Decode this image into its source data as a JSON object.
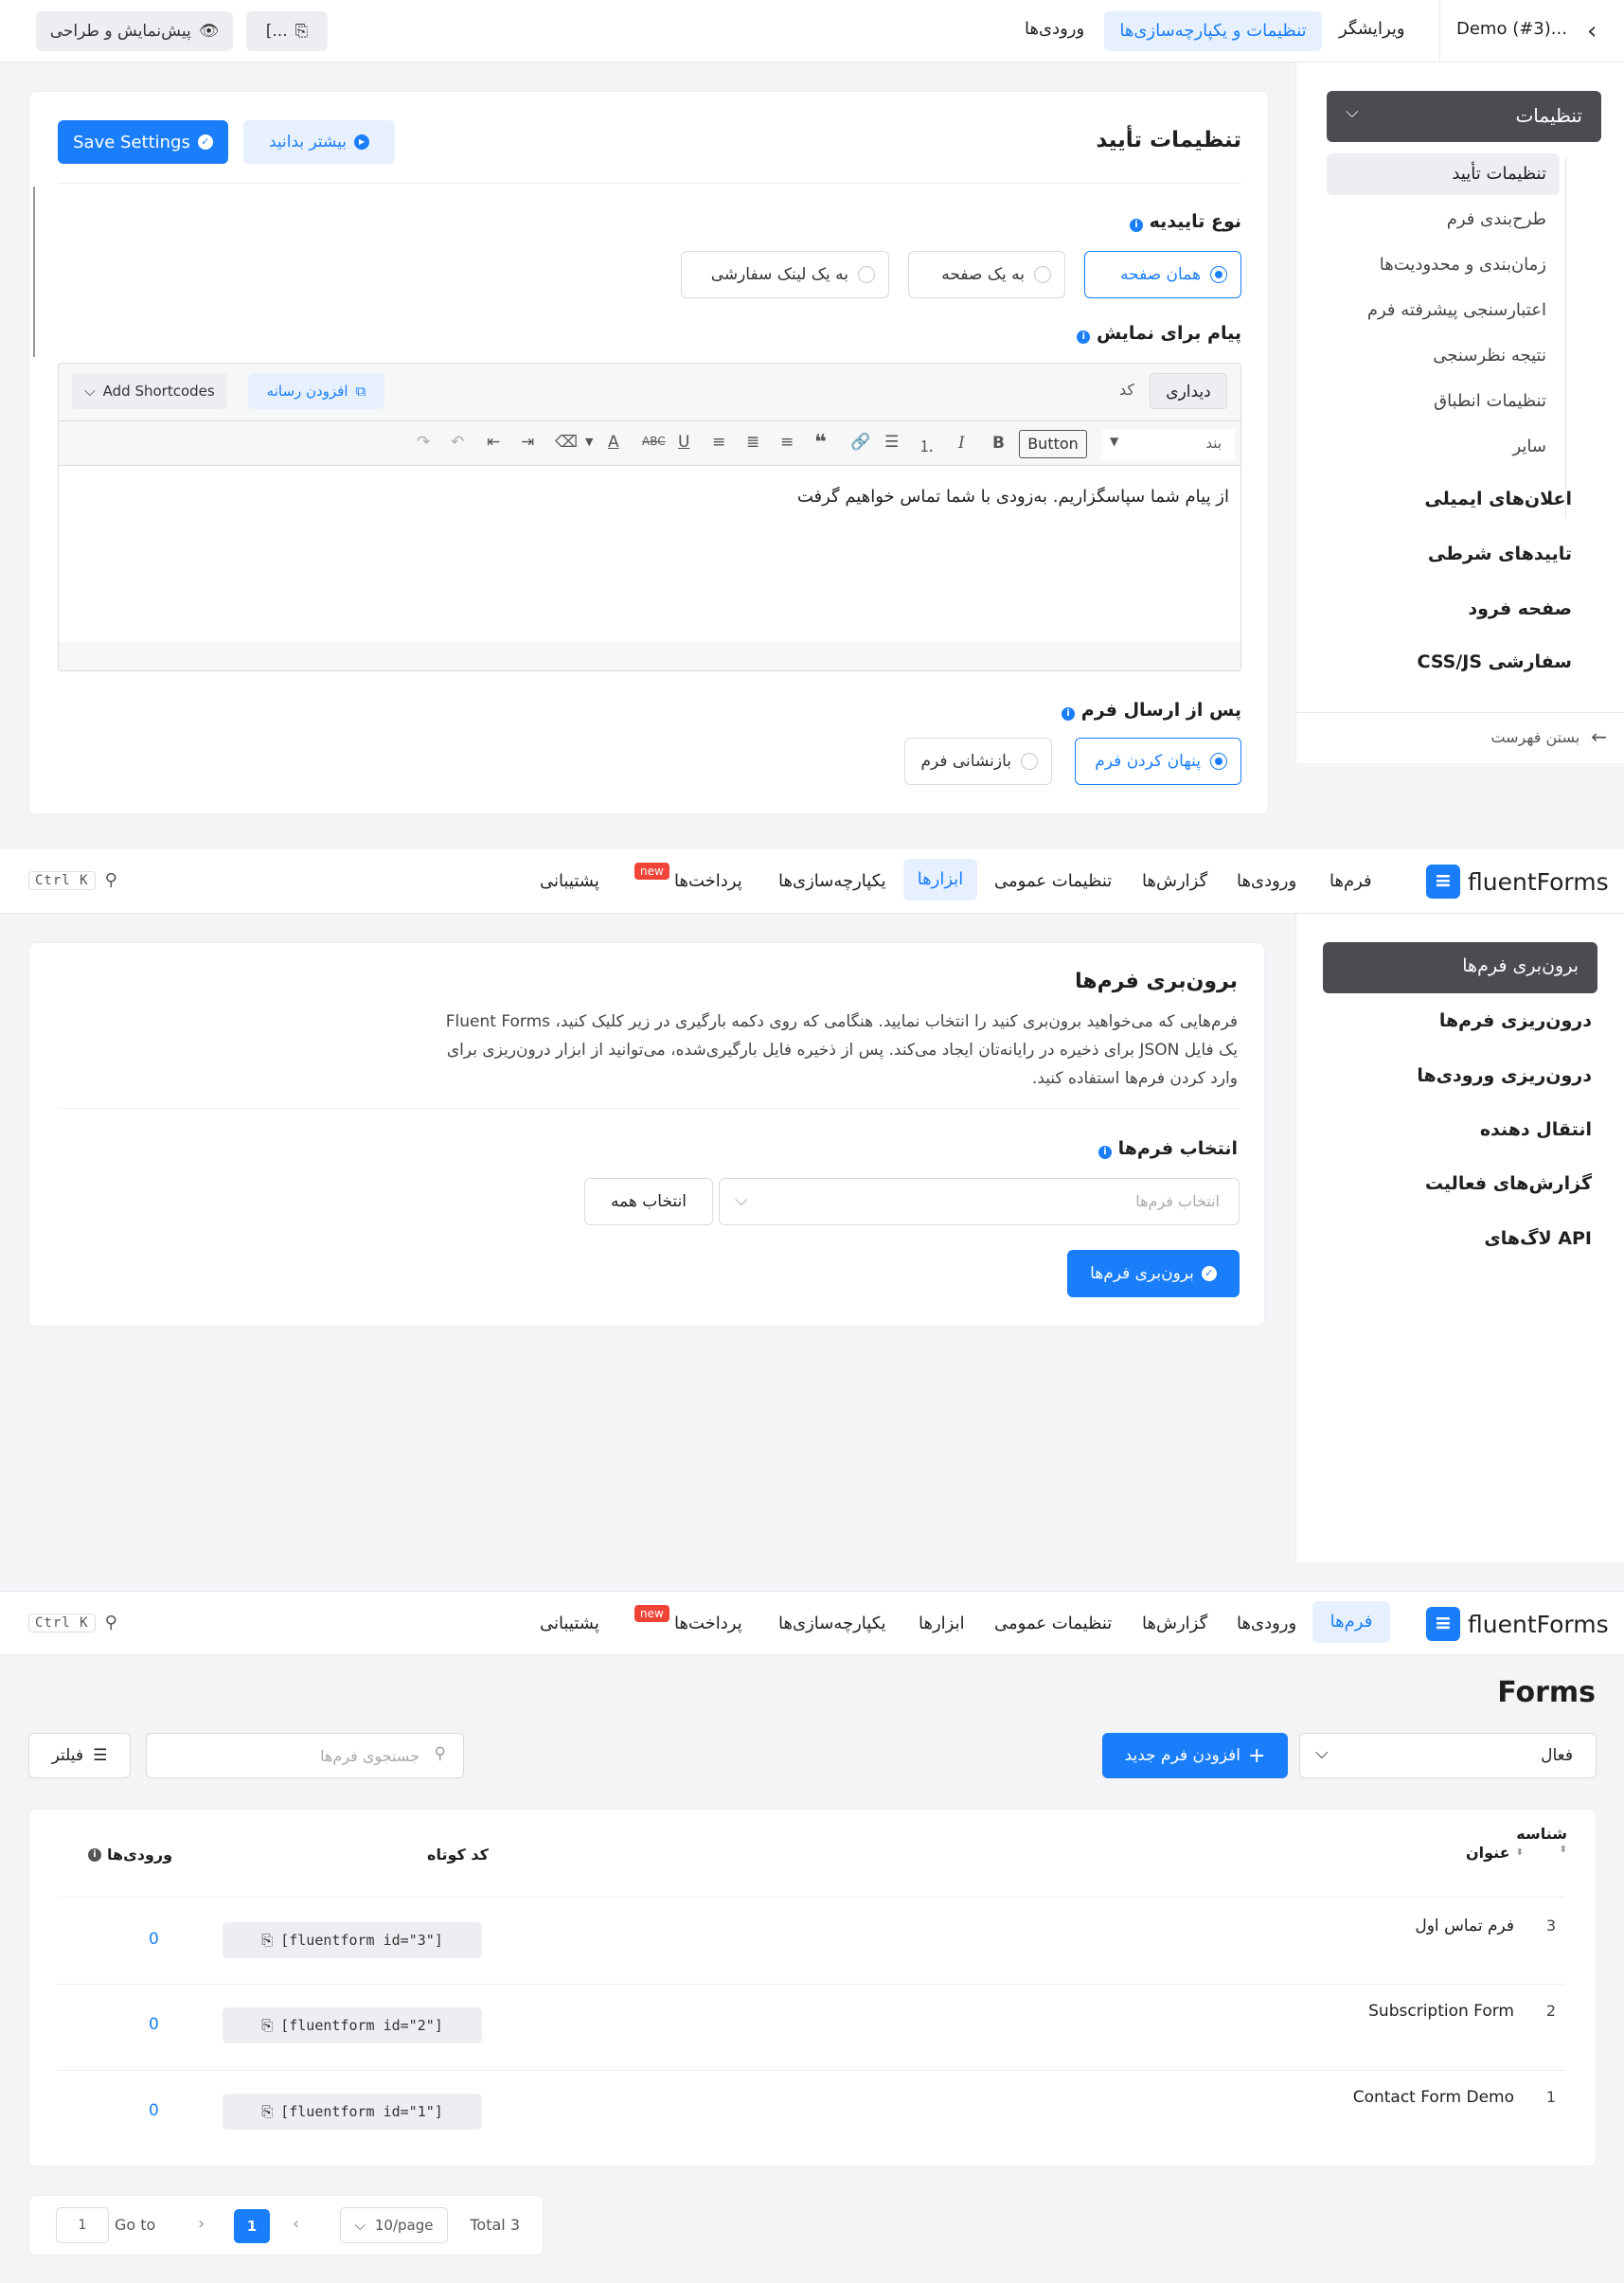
{
  "editor_top": {
    "back_icon": "chevron-left-icon",
    "form_name": "Demo (#3)...",
    "tabs": [
      "ویرایشگر",
      "تنظیمات و یکپارچه‌سازی‌ها",
      "ورودی‌ها"
    ],
    "active_tab": "تنظیمات و یکپارچه‌سازی‌ها",
    "shortcode_button": "[...",
    "preview_button": "پیش‌نمایش و طراحی"
  },
  "settings_sidebar": {
    "dropdown_label": "تنظیمات",
    "sub_items": [
      "تنظیمات تأیید",
      "طرح‌بندی فرم",
      "زمان‌بندی و محدودیت‌ها",
      "اعتبارسنجی پیشرفته فرم",
      "نتیجه نظرسنجی",
      "تنظیمات انطباق",
      "سایر"
    ],
    "main_items": [
      "اعلان‌های ایمیلی",
      "تاییدهای شرطی",
      "صفحه فرود",
      "CSS/JS سفارشی"
    ],
    "close_menu": "بستن فهرست"
  },
  "confirmation": {
    "title": "تنظیمات تأیید",
    "learn_more": "بیشتر بدانید",
    "save_button": "Save Settings",
    "type_label": "نوع تاییدیه",
    "type_options": [
      "همان صفحه",
      "به یک صفحه",
      "به یک لینک سفارشی"
    ],
    "message_label": "پیام برای نمایش",
    "add_media": "افزودن رسانه",
    "add_shortcodes": "Add Shortcodes",
    "visual_tab": "دیداری",
    "code_tab": "کد",
    "paragraph_select": "بند",
    "button_label": "Button",
    "message_text": "از پیام شما سپاسگزاریم. به‌زودی با شما تماس خواهیم گرفت",
    "after_submit_label": "پس از ارسال فرم",
    "after_options": [
      "پنهان کردن فرم",
      "بازنشانی فرم"
    ]
  },
  "main_nav": {
    "brand": "fluentForms",
    "items": [
      "فرم‌ها",
      "ورودی‌ها",
      "گزارش‌ها",
      "تنظیمات عمومی",
      "ابزارها",
      "یکپارچه‌سازی‌ها",
      "پرداخت‌ها",
      "پشتیبانی"
    ],
    "new_badge": "new",
    "search_shortcut": "Ctrl K"
  },
  "tools_sidebar": {
    "items": [
      "برون‌بری فرم‌ها",
      "درون‌ریزی فرم‌ها",
      "درون‌ریزی ورودی‌ها",
      "انتقال دهنده",
      "گزارش‌های فعالیت",
      "لاگ‌های API"
    ]
  },
  "export": {
    "title": "برون‌بری فرم‌ها",
    "desc_lines": [
      "فرم‌هایی که می‌خواهید برون‌بری کنید را انتخاب نمایید. هنگامی که روی دکمه بارگیری در زیر کلیک کنید، Fluent Forms",
      "یک فایل JSON برای ذخیره در رایانه‌تان ایجاد می‌کند. پس از ذخیره فایل بارگیری‌شده، می‌توانید از ابزار درون‌ریزی برای",
      "وارد کردن فرم‌ها استفاده کنید."
    ],
    "select_label": "انتخاب فرم‌ها",
    "select_placeholder": "انتخاب فرم‌ها",
    "select_all": "انتخاب همه",
    "export_button": "برون‌بری فرم‌ها"
  },
  "forms_page": {
    "title": "Forms",
    "status_filter": "فعال",
    "add_new": "افزودن فرم جدید",
    "search_placeholder": "جستجوی فرم‌ها",
    "filter_button": "فیلتر",
    "columns": {
      "id": "شناسه",
      "title": "عنوان",
      "shortcode": "کد کوتاه",
      "entries": "ورودی‌ها"
    },
    "rows": [
      {
        "id": "3",
        "title": "فرم تماس اول",
        "shortcode": "[fluentform id=\"3\"]",
        "entries": "0"
      },
      {
        "id": "2",
        "title": "Subscription Form",
        "shortcode": "[fluentform id=\"2\"]",
        "entries": "0"
      },
      {
        "id": "1",
        "title": "Contact Form Demo",
        "shortcode": "[fluentform id=\"1\"]",
        "entries": "0"
      }
    ],
    "pagination": {
      "total": "Total 3",
      "per_page": "10/page",
      "current": "1",
      "goto": "Go to",
      "goto_value": "1"
    }
  },
  "colors": {
    "accent": "#1a7efb",
    "dark": "#4a4c50",
    "new_badge": "#f04438"
  }
}
